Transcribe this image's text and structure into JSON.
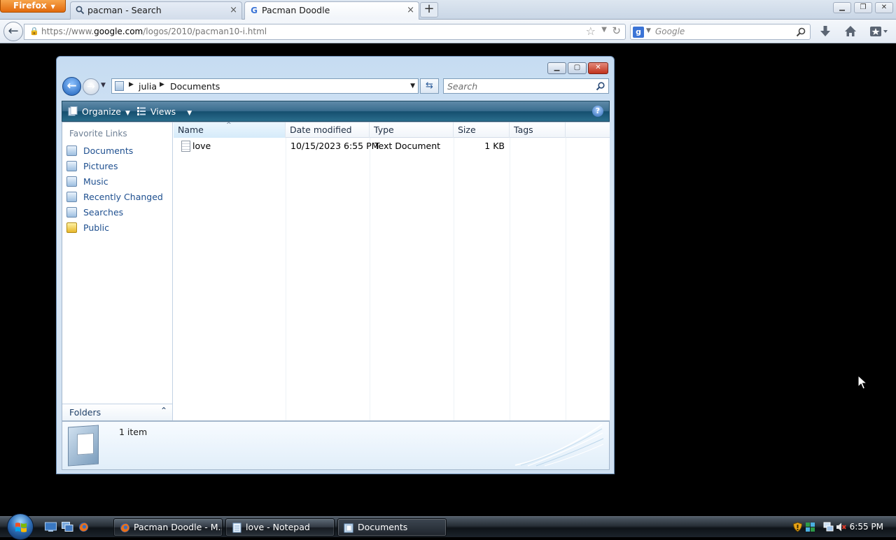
{
  "browser": {
    "menu_button": "Firefox",
    "tabs": [
      {
        "title": "pacman - Search",
        "icon": "search-icon"
      },
      {
        "title": "Pacman Doodle",
        "icon": "google-g-icon"
      }
    ],
    "url_prefix": "https://www.",
    "url_domain": "google.com",
    "url_path": "/logos/2010/pacman10-i.html",
    "search_placeholder": "Google",
    "search_engine_icon": "g"
  },
  "explorer": {
    "breadcrumbs": [
      "julia",
      "Documents"
    ],
    "search_placeholder": "Search",
    "toolbar": {
      "organize": "Organize",
      "views": "Views"
    },
    "favorites_heading": "Favorite Links",
    "favorites": [
      {
        "label": "Documents",
        "icon": "documents-icon"
      },
      {
        "label": "Pictures",
        "icon": "pictures-icon"
      },
      {
        "label": "Music",
        "icon": "music-icon"
      },
      {
        "label": "Recently Changed",
        "icon": "recently-changed-icon"
      },
      {
        "label": "Searches",
        "icon": "searches-icon"
      },
      {
        "label": "Public",
        "icon": "folder-icon"
      }
    ],
    "folders_label": "Folders",
    "columns": [
      "Name",
      "Date modified",
      "Type",
      "Size",
      "Tags"
    ],
    "files": [
      {
        "name": "love",
        "date": "10/15/2023 6:55 PM",
        "type": "Text Document",
        "size": "1 KB",
        "tags": ""
      }
    ],
    "details": "1 item"
  },
  "taskbar": {
    "buttons": [
      {
        "label": "Pacman Doodle - M...",
        "icon": "firefox-icon"
      },
      {
        "label": "love - Notepad",
        "icon": "notepad-icon"
      },
      {
        "label": "Documents",
        "icon": "explorer-icon"
      }
    ],
    "clock": "6:55 PM"
  },
  "colors": {
    "firefox_button": "#e26a0d",
    "link_blue": "#1e4f8f",
    "toolbar_teal": "#154f6f"
  }
}
